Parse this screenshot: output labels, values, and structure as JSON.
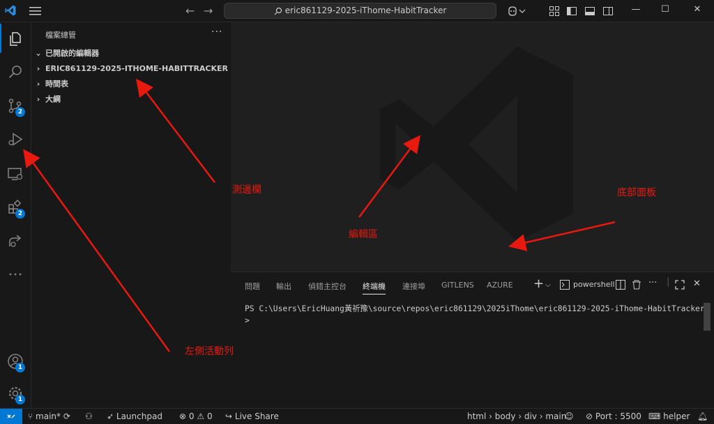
{
  "titlebar": {
    "search_text": "eric861129-2025-iThome-HabitTracker"
  },
  "activitybar": {
    "source_control_badge": "2",
    "extensions_badge": "2",
    "accounts_badge": "1",
    "settings_badge": "1"
  },
  "sidebar": {
    "title": "檔案總管",
    "more": "···",
    "sections": [
      "已開啟的編輯器",
      "ERIC861129-2025-ITHOME-HABITTRACKER",
      "時間表",
      "大綱"
    ]
  },
  "panel": {
    "tabs": [
      "問題",
      "輸出",
      "偵錯主控台",
      "終端機",
      "連接埠",
      "GITLENS",
      "AZURE"
    ],
    "terminal_name": "powershell",
    "terminal_text": "PS C:\\Users\\EricHuang黃祈豫\\source\\repos\\eric861129\\2025iThome\\eric861129-2025-iThome-HabitTracker>"
  },
  "statusbar": {
    "branch": "main*",
    "launchpad": "Launchpad",
    "errors": "0",
    "warnings": "0",
    "live_share": "Live Share",
    "breadcrumb": "html › body › div › main",
    "port": "Port : 5500",
    "helper": "helper"
  },
  "annotations": {
    "sidebar_label": "測邊欄",
    "editor_label": "編輯區",
    "panel_label": "底部面板",
    "activity_label": "左側活動列"
  }
}
